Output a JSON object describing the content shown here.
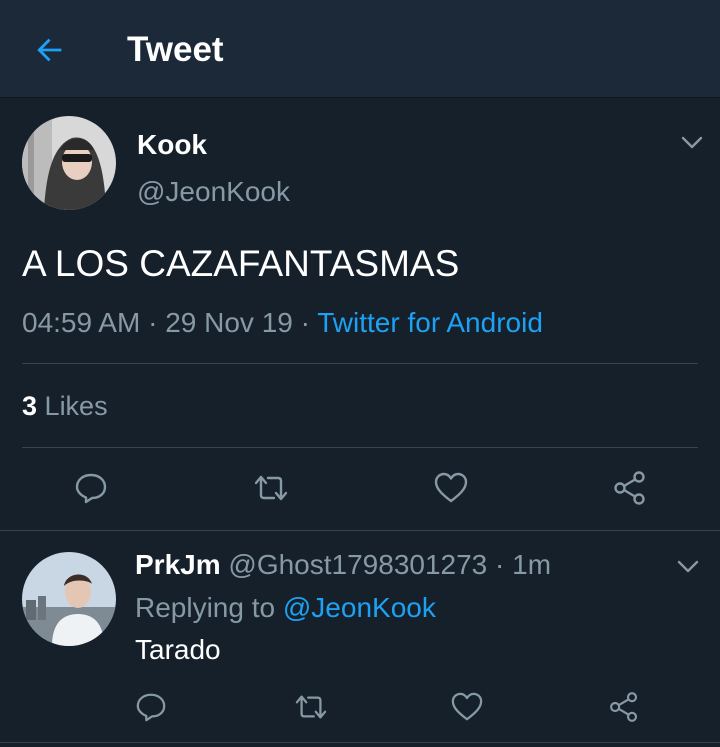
{
  "header": {
    "title": "Tweet",
    "back_icon": "arrow-left-icon"
  },
  "colors": {
    "background": "#15202b",
    "header_background": "#1c2938",
    "accent": "#1da1f2",
    "secondary_text": "#8899a6",
    "divider": "#38444d"
  },
  "tweet": {
    "author_name": "Kook",
    "author_handle": "@JeonKook",
    "text": "A LOS CAZAFANTASMAS",
    "time": "04:59 AM",
    "date": "29 Nov 19",
    "separator": " · ",
    "source": "Twitter for Android",
    "likes_count": "3",
    "likes_label": "Likes",
    "actions": [
      "reply-icon",
      "retweet-icon",
      "like-icon",
      "share-icon"
    ]
  },
  "reply": {
    "author_name": "PrkJm",
    "author_handle": "@Ghost1798301273",
    "time": "1m",
    "separator": " · ",
    "replying_prefix": "Replying to ",
    "replying_to": "@JeonKook",
    "text": "Tarado",
    "actions": [
      "reply-icon",
      "retweet-icon",
      "like-icon",
      "share-icon"
    ]
  }
}
